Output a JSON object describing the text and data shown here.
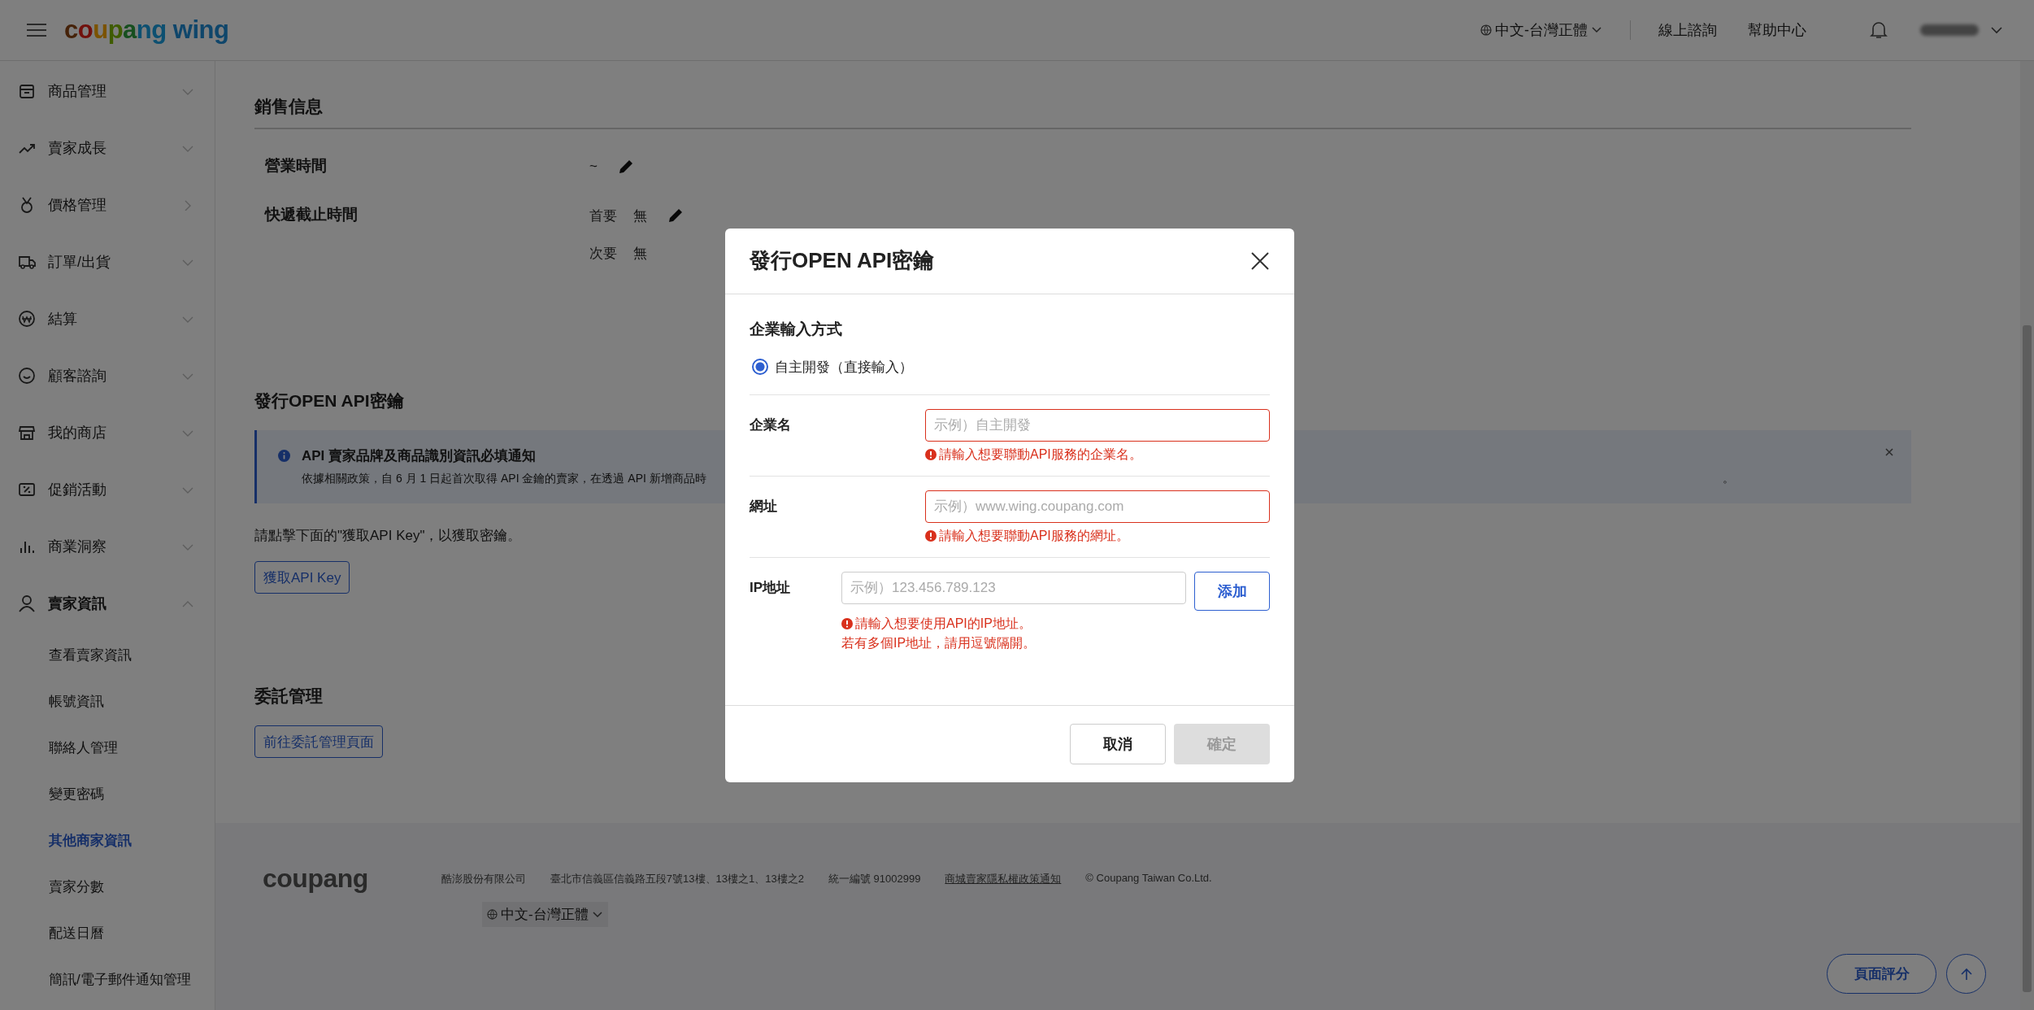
{
  "topbar": {
    "logo": "coupang wing",
    "language": "中文-台灣正體",
    "links": [
      "線上諮詢",
      "幫助中心"
    ]
  },
  "sidebar": {
    "items": [
      {
        "label": "商品管理",
        "kind": "group",
        "expanded": false
      },
      {
        "label": "賣家成長",
        "kind": "group",
        "expanded": false
      },
      {
        "label": "價格管理",
        "kind": "link",
        "expanded": false
      },
      {
        "label": "訂單/出貨",
        "kind": "group",
        "expanded": false
      },
      {
        "label": "結算",
        "kind": "group",
        "expanded": false
      },
      {
        "label": "顧客諮詢",
        "kind": "group",
        "expanded": false
      },
      {
        "label": "我的商店",
        "kind": "group",
        "expanded": false
      },
      {
        "label": "促銷活動",
        "kind": "group",
        "expanded": false
      },
      {
        "label": "商業洞察",
        "kind": "group",
        "expanded": false
      },
      {
        "label": "賣家資訊",
        "kind": "group",
        "expanded": true,
        "children": [
          {
            "label": "查看賣家資訊",
            "selected": false
          },
          {
            "label": "帳號資訊",
            "selected": false
          },
          {
            "label": "聯絡人管理",
            "selected": false
          },
          {
            "label": "變更密碼",
            "selected": false
          },
          {
            "label": "其他商家資訊",
            "selected": true
          },
          {
            "label": "賣家分數",
            "selected": false
          },
          {
            "label": "配送日曆",
            "selected": false
          },
          {
            "label": "簡訊/電子郵件通知管理",
            "selected": false
          }
        ]
      }
    ]
  },
  "sales_info": {
    "title": "銷售信息",
    "rows": [
      {
        "label": "營業時間",
        "lines": [
          {
            "value": "~"
          }
        ]
      },
      {
        "label": "快遞截止時間",
        "lines": [
          {
            "name": "首要",
            "value": "無"
          },
          {
            "name": "次要",
            "value": "無"
          }
        ]
      }
    ]
  },
  "api_section": {
    "title": "發行OPEN API密鑰",
    "notice": {
      "title": "API 賣家品牌及商品識別資訊必填通知",
      "text": "依據相關政策，自 6 月 1 日起首次取得 API 金鑰的賣家，在透過 API 新增商品時",
      "text_tail": "。"
    },
    "instruction": "請點擊下面的\"獲取API Key\"，以獲取密鑰。",
    "button": "獲取API Key"
  },
  "delegation": {
    "title": "委託管理",
    "button": "前往委託管理頁面"
  },
  "footer": {
    "logo": "coupang",
    "items": [
      {
        "text": "酷澎股份有限公司",
        "link": false
      },
      {
        "text": "臺北市信義區信義路五段7號13樓、13樓之1、13樓之2",
        "link": false
      },
      {
        "text": "統一編號 91002999",
        "link": false
      },
      {
        "text": "商城賣家隱私權政策通知",
        "link": true
      },
      {
        "text": "© Coupang Taiwan Co.Ltd.",
        "link": false
      }
    ],
    "language": "中文-台灣正體",
    "rate_button": "頁面評分"
  },
  "modal": {
    "title": "發行OPEN API密鑰",
    "section_label": "企業輸入方式",
    "radio": {
      "label": "自主開發（直接輸入）",
      "selected": true
    },
    "fields": [
      {
        "label": "企業名",
        "placeholder": "示例）自主開發",
        "invalid": true,
        "error_lines": [
          "請輸入想要聯動API服務的企業名。"
        ]
      },
      {
        "label": "網址",
        "placeholder": "示例）www.wing.coupang.com",
        "invalid": true,
        "error_lines": [
          "請輸入想要聯動API服務的網址。"
        ]
      },
      {
        "label": "IP地址",
        "placeholder": "示例）123.456.789.123",
        "invalid": false,
        "add_button": "添加",
        "error_lines": [
          "請輸入想要使用API的IP地址。",
          "若有多個IP地址，請用逗號隔開。"
        ]
      }
    ],
    "buttons": [
      {
        "label": "取消",
        "kind": "secondary",
        "disabled": false
      },
      {
        "label": "確定",
        "kind": "primary",
        "disabled": true
      }
    ]
  }
}
